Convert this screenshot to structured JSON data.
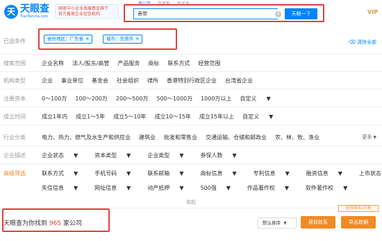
{
  "header": {
    "logo_mark": "天",
    "logo_cn": "天眼查",
    "logo_en": "TianYancha.com",
    "promo_line1": "国家中小企业发展基金旗下",
    "promo_line2": "官方备案企业征信机构",
    "search_tabs": [
      "查公司",
      "查老板",
      "查关系"
    ],
    "search_value": "表带",
    "search_button": "天眼一下",
    "vip_label": "VIP"
  },
  "filters": {
    "selected_label": "已选条件",
    "selected_tags": [
      "省份地区：广东省",
      "城市：东莞市"
    ],
    "clear_all": "清除全部",
    "rows": [
      {
        "label": "搜索范围",
        "items": [
          "企业名称",
          "法人/股东/高管",
          "产品服务",
          "商标",
          "联系方式",
          "经营范围"
        ]
      },
      {
        "label": "机构类型",
        "items": [
          "企业",
          "事业单位",
          "基金会",
          "社会组织",
          "律所",
          "香港特别行政区企业",
          "台湾省企业"
        ]
      },
      {
        "label": "注册资本",
        "items": [
          "0～100万",
          "100～200万",
          "200～500万",
          "500～1000万",
          "1000万以上",
          "自定义"
        ]
      },
      {
        "label": "成立时间",
        "items": [
          "成立1年内",
          "成立1～5年",
          "成立5～10年",
          "成立10～15年",
          "成立15年以上",
          "自定义"
        ]
      },
      {
        "label": "行业分类",
        "items": [
          "电力、热力、燃气及水生产和供应业",
          "建筑业",
          "批发和零售业",
          "交通运输、仓储和邮政业",
          "农、林、牧、渔业"
        ]
      },
      {
        "label": "企业描述",
        "items": [
          "企业状态",
          "资本类型",
          "企业类型",
          "参保人数"
        ]
      },
      {
        "label": "高级筛选",
        "items": [
          "联系方式",
          "手机号码",
          "联系邮箱",
          "商标信息",
          "专利信息",
          "融资信息",
          "上市状态"
        ]
      },
      {
        "label": "",
        "items": [
          "失信信息",
          "网址信息",
          "动产抵押",
          "500强",
          "作品著作权",
          "软件著作权"
        ]
      }
    ],
    "more_label": "更多",
    "collapse_label": "收起"
  },
  "results": {
    "prefix": "天眼查为你找到",
    "count": "965",
    "suffix": "家公司",
    "sort_label": "默认排序",
    "export_tip": "支持导出2万条",
    "contact_button": "获取联系",
    "export_button": "导出数据"
  },
  "colors": {
    "brand_blue": "#0084ff",
    "annotation_red": "#e0403a",
    "accent_orange": "#f08a24"
  }
}
